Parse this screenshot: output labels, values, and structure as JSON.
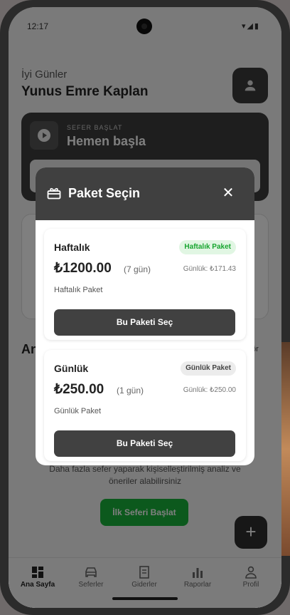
{
  "status": {
    "time": "12:17",
    "icons": "▾◢▮"
  },
  "header": {
    "greeting": "İyi Günler",
    "username": "Yunus Emre Kaplan"
  },
  "start_card": {
    "eyebrow": "SEFER BAŞLAT",
    "title": "Hemen başla"
  },
  "section": {
    "title": "An",
    "link": "ör"
  },
  "empty_state": {
    "description": "Daha fazla sefer yaparak kişiselleştirilmiş analiz ve öneriler alabilirsiniz",
    "button": "İlk Seferi Başlat"
  },
  "fab": {
    "label": "+"
  },
  "nav": [
    {
      "label": "Ana Sayfa",
      "icon": "dashboard-icon",
      "active": true
    },
    {
      "label": "Seferler",
      "icon": "car-icon"
    },
    {
      "label": "Giderler",
      "icon": "receipt-icon"
    },
    {
      "label": "Raporlar",
      "icon": "bar-chart-icon"
    },
    {
      "label": "Profil",
      "icon": "person-icon"
    }
  ],
  "modal": {
    "title": "Paket Seçin",
    "close": "✕",
    "packages": [
      {
        "name": "Haftalık",
        "badge": "Haftalık Paket",
        "price": "₺1200.00",
        "days": "(7 gün)",
        "daily": "Günlük: ₺171.43",
        "description": "Haftalık Paket",
        "button": "Bu Paketi Seç"
      },
      {
        "name": "Günlük",
        "badge": "Günlük Paket",
        "price": "₺250.00",
        "days": "(1 gün)",
        "daily": "Günlük: ₺250.00",
        "description": "Günlük Paket",
        "button": "Bu Paketi Seç"
      }
    ]
  },
  "colors": {
    "accent_green": "#19b33a",
    "dark": "#404040",
    "badge_green_text": "#17a52f"
  }
}
